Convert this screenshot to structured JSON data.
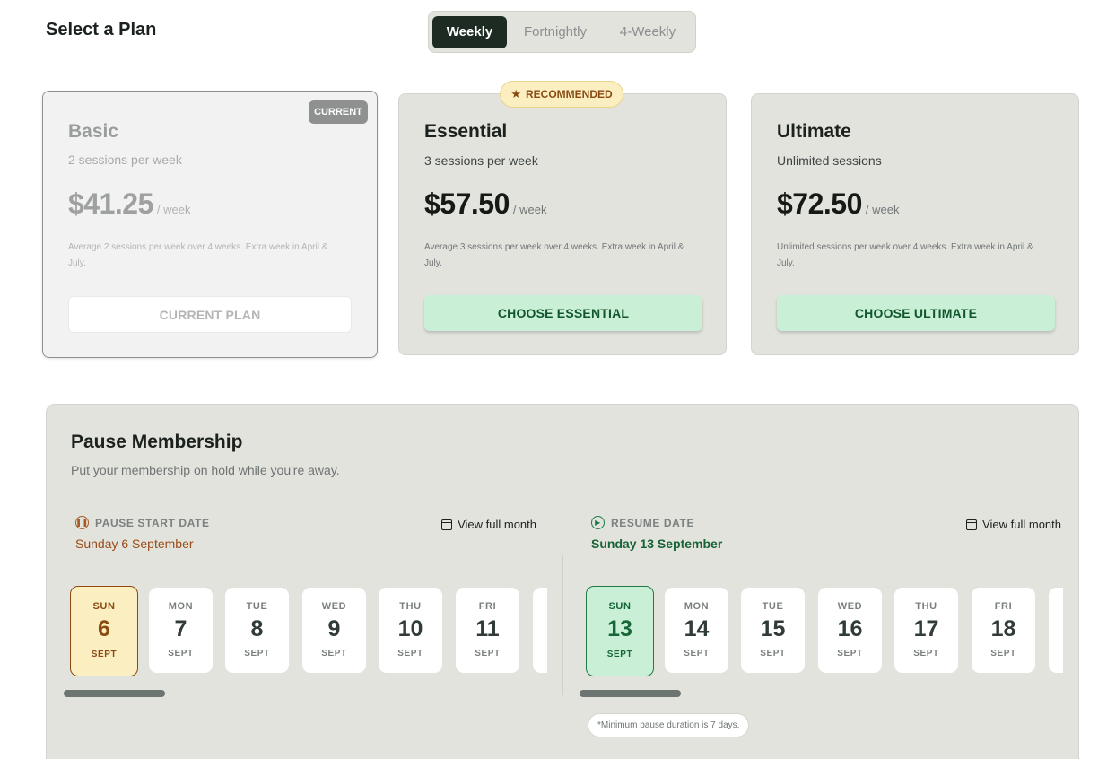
{
  "page": {
    "title": "Select a Plan"
  },
  "frequency": {
    "tabs": [
      {
        "label": "Weekly",
        "active": true
      },
      {
        "label": "Fortnightly",
        "active": false
      },
      {
        "label": "4-Weekly",
        "active": false
      }
    ]
  },
  "plans": [
    {
      "name": "Basic",
      "subtitle": "2 sessions per week",
      "price": "$41.25",
      "unit": "/ week",
      "note": "Average 2 sessions per week over 4 weeks. Extra week in April & July.",
      "button": "CURRENT PLAN",
      "badge": "CURRENT"
    },
    {
      "name": "Essential",
      "subtitle": "3 sessions per week",
      "price": "$57.50",
      "unit": "/ week",
      "note": "Average 3 sessions per week over 4 weeks. Extra week in April & July.",
      "button": "CHOOSE ESSENTIAL",
      "badge": "RECOMMENDED"
    },
    {
      "name": "Ultimate",
      "subtitle": "Unlimited sessions",
      "price": "$72.50",
      "unit": "/ week",
      "note": "Unlimited sessions per week over 4 weeks. Extra week in April & July.",
      "button": "CHOOSE ULTIMATE"
    }
  ],
  "pause": {
    "title": "Pause Membership",
    "subtitle": "Put your membership on hold while you're away.",
    "start": {
      "label": "PAUSE START DATE",
      "selected": "Sunday 6 September",
      "view_month": "View full month",
      "days": [
        {
          "dow": "SUN",
          "num": "6",
          "mon": "SEPT"
        },
        {
          "dow": "MON",
          "num": "7",
          "mon": "SEPT"
        },
        {
          "dow": "TUE",
          "num": "8",
          "mon": "SEPT"
        },
        {
          "dow": "WED",
          "num": "9",
          "mon": "SEPT"
        },
        {
          "dow": "THU",
          "num": "10",
          "mon": "SEPT"
        },
        {
          "dow": "FRI",
          "num": "11",
          "mon": "SEPT"
        },
        {
          "dow": "",
          "num": "",
          "mon": ""
        }
      ]
    },
    "resume": {
      "label": "RESUME DATE",
      "selected": "Sunday 13 September",
      "view_month": "View full month",
      "days": [
        {
          "dow": "SUN",
          "num": "13",
          "mon": "SEPT"
        },
        {
          "dow": "MON",
          "num": "14",
          "mon": "SEPT"
        },
        {
          "dow": "TUE",
          "num": "15",
          "mon": "SEPT"
        },
        {
          "dow": "WED",
          "num": "16",
          "mon": "SEPT"
        },
        {
          "dow": "THU",
          "num": "17",
          "mon": "SEPT"
        },
        {
          "dow": "FRI",
          "num": "18",
          "mon": "SEPT"
        },
        {
          "dow": "",
          "num": "",
          "mon": ""
        }
      ]
    },
    "min_note": "*Minimum pause duration is 7 days."
  },
  "icons": {
    "star": "star-icon",
    "pause": "pause-circle-icon",
    "play": "play-circle-icon",
    "calendar": "calendar-icon"
  },
  "colors": {
    "accent_dark": "#1e2b22",
    "choose_bg": "#c9f0d6",
    "choose_text": "#11552c",
    "recommended_bg": "#fbefc2",
    "start_accent": "#8a4a12",
    "resume_accent": "#1f7a45",
    "card_bg": "#e3e3de"
  }
}
